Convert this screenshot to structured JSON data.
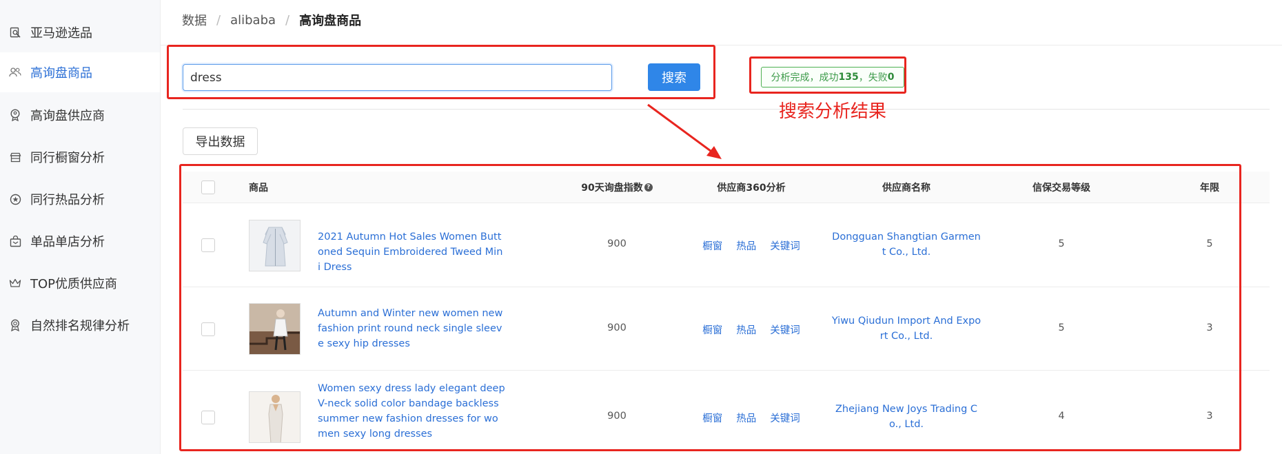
{
  "sidebar": {
    "items": [
      {
        "label": "亚马逊选品",
        "icon": "search-doc-icon"
      },
      {
        "label": "高询盘商品",
        "icon": "users-icon",
        "active": true
      },
      {
        "label": "高询盘供应商",
        "icon": "badge-icon"
      },
      {
        "label": "同行橱窗分析",
        "icon": "store-icon"
      },
      {
        "label": "同行热品分析",
        "icon": "star-circle-icon"
      },
      {
        "label": "单品单店分析",
        "icon": "shop-bag-icon"
      },
      {
        "label": "TOP优质供应商",
        "icon": "crown-icon"
      },
      {
        "label": "自然排名规律分析",
        "icon": "award-icon"
      }
    ]
  },
  "breadcrumb": {
    "items": [
      "数据",
      "alibaba"
    ],
    "current": "高询盘商品",
    "separator": "/"
  },
  "search": {
    "value": "dress",
    "button_label": "搜索"
  },
  "status": {
    "prefix": "分析完成，成功",
    "success": "135",
    "middle": "，失败",
    "fail": "0"
  },
  "annotation": {
    "label": "搜索分析结果",
    "color": "#e8251f"
  },
  "toolbar": {
    "export_label": "导出数据"
  },
  "table": {
    "columns": {
      "product": "商品",
      "inquiry": "90天询盘指数",
      "analysis": "供应商360分析",
      "supplier": "供应商名称",
      "trade_level": "信保交易等级",
      "years": "年限"
    },
    "analysis_links": [
      "橱窗",
      "热品",
      "关键词"
    ],
    "rows": [
      {
        "title": "2021 Autumn Hot Sales Women Buttoned Sequin Embroidered Tweed Mini Dress",
        "inquiry": "900",
        "supplier": "Dongguan Shangtian Garment Co., Ltd.",
        "trade_level": "5",
        "years": "5"
      },
      {
        "title": "Autumn and Winter new women new fashion print round neck single sleeve sexy hip dresses",
        "inquiry": "900",
        "supplier": "Yiwu Qiudun Import And Export Co., Ltd.",
        "trade_level": "5",
        "years": "3"
      },
      {
        "title": "Women sexy dress lady elegant deep V-neck solid color bandage backless summer new fashion dresses for women sexy long dresses",
        "inquiry": "900",
        "supplier": "Zhejiang New Joys Trading Co., Ltd.",
        "trade_level": "4",
        "years": "3"
      }
    ]
  },
  "colors": {
    "accent": "#2f86e8",
    "link": "#2b6fd6",
    "success": "#3c9a49",
    "annotation": "#e8251f"
  }
}
